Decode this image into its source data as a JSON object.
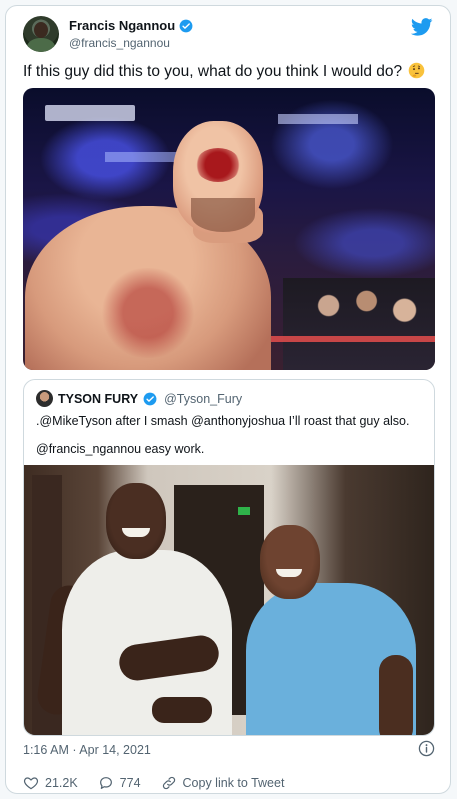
{
  "author": {
    "name": "Francis Ngannou",
    "handle": "@francis_ngannou"
  },
  "tweet": {
    "text": "If this guy did this to you, what do you think I would do?",
    "emoji": "thinking-face-icon"
  },
  "quoted": {
    "name": "TYSON FURY",
    "handle": "@Tyson_Fury",
    "line1": ".@MikeTyson after I smash @anthonyjoshua I’ll roast that guy also.",
    "line2": "@francis_ngannou easy work."
  },
  "meta": {
    "time": "1:16 AM · Apr 14, 2021"
  },
  "actions": {
    "likes": "21.2K",
    "replies": "774",
    "copy_link": "Copy link to Tweet"
  },
  "colors": {
    "twitter_blue": "#1d9bf0",
    "secondary_text": "#536471",
    "border": "#cfd9de"
  }
}
